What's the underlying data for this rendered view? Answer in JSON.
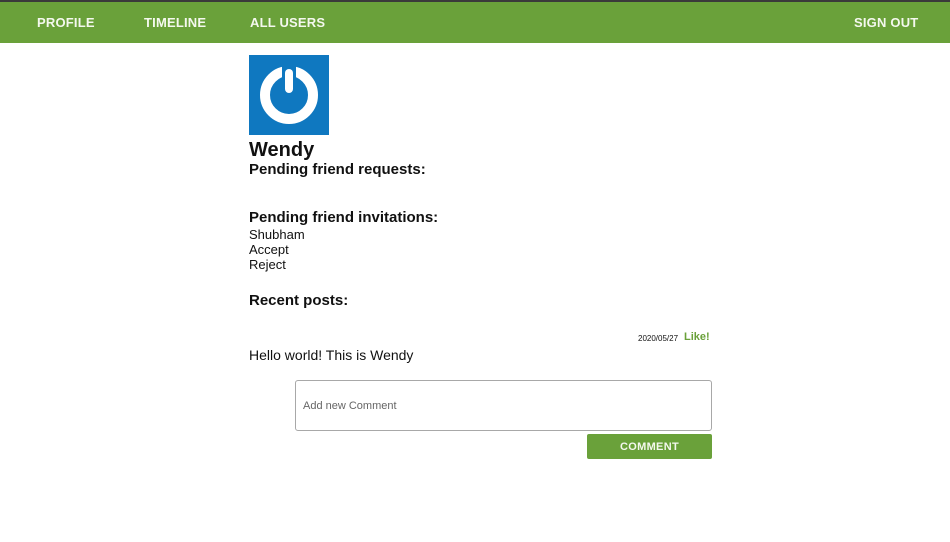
{
  "nav": {
    "profile_label": "PROFILE",
    "timeline_label": "TIMELINE",
    "all_users_label": "ALL USERS",
    "sign_out_label": "SIGN OUT"
  },
  "colors": {
    "brand_green": "#6aa13a",
    "avatar_blue": "#0f78c0"
  },
  "profile": {
    "avatar_icon": "power-button-icon",
    "name": "Wendy"
  },
  "friend_requests": {
    "heading": "Pending friend requests:"
  },
  "friend_invitations": {
    "heading": "Pending friend invitations:",
    "items": [
      {
        "name": "Shubham",
        "accept_label": "Accept",
        "reject_label": "Reject"
      }
    ]
  },
  "posts": {
    "heading": "Recent posts:",
    "items": [
      {
        "date": "2020/05/27",
        "like_label": "Like!",
        "text": "Hello world! This is Wendy",
        "comment_placeholder": "Add new Comment",
        "comment_button_label": "COMMENT"
      }
    ]
  }
}
